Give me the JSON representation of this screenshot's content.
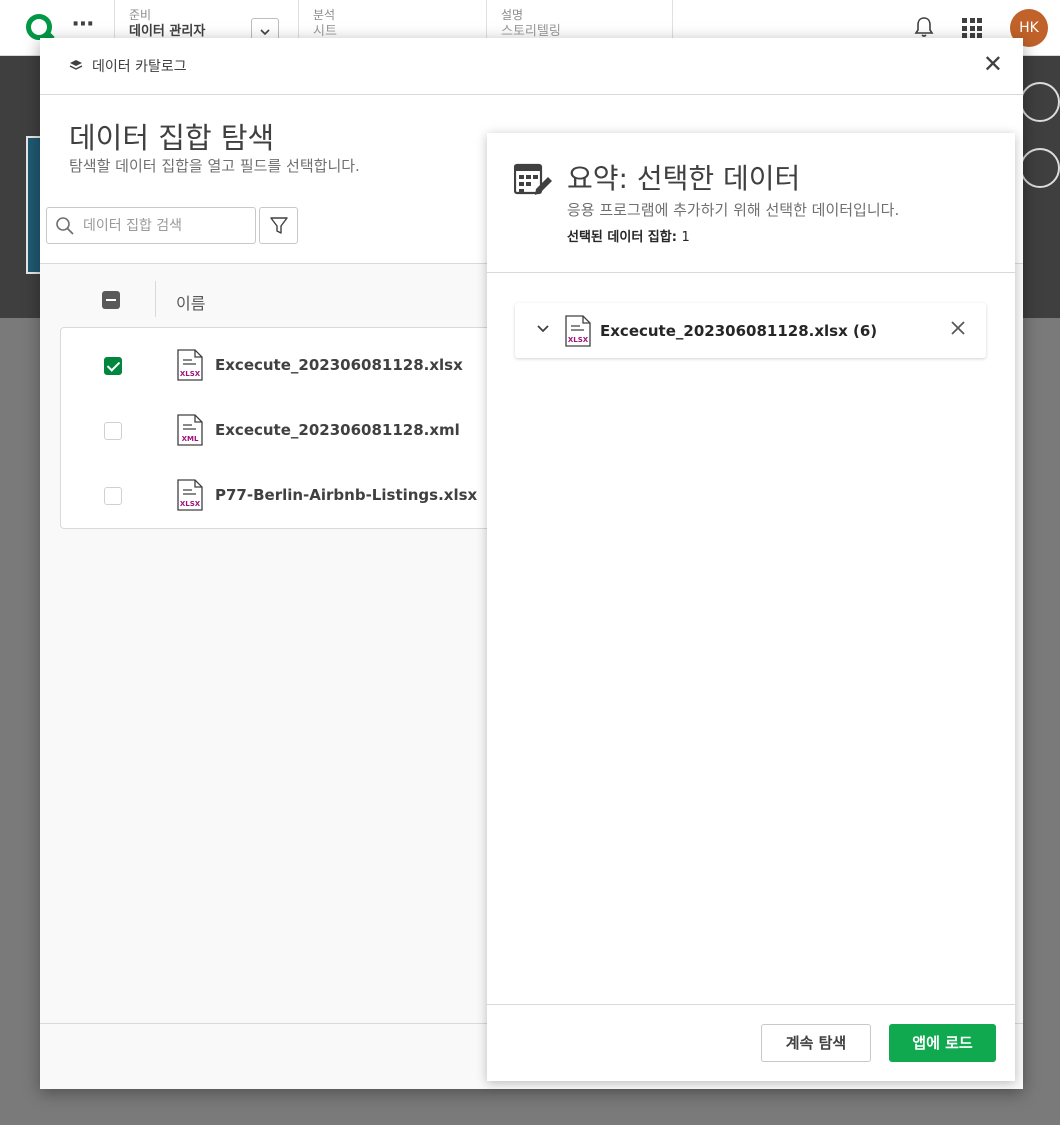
{
  "appbar": {
    "more_label": "⋯",
    "sections": [
      {
        "small": "준비",
        "big": "데이터 관리자"
      },
      {
        "small": "분석",
        "big": "시트"
      },
      {
        "small": "설명",
        "big": "스토리텔링"
      }
    ],
    "avatar_initials": "HK"
  },
  "modal": {
    "header_title": "데이터 카탈로그",
    "close_label": "✕",
    "title": "데이터 집합 탐색",
    "subtitle": "탐색할 데이터 집합을 열고 필드를 선택합니다.",
    "search_placeholder": "데이터 집합 검색",
    "table_header_name": "이름",
    "rows": [
      {
        "name": "Excecute_202306081128.xlsx",
        "type": "XLSX",
        "checked": true
      },
      {
        "name": "Excecute_202306081128.xml",
        "type": "XML",
        "checked": false
      },
      {
        "name": "P77-Berlin-Airbnb-Listings.xlsx",
        "type": "XLSX",
        "checked": false
      }
    ]
  },
  "summary": {
    "title": "요약: 선택한 데이터",
    "subtitle": "응용 프로그램에 추가하기 위해 선택한 데이터입니다.",
    "count_label": "선택된 데이터 집합:",
    "count_value": "1",
    "selected_item": {
      "name": "Excecute_202306081128.xlsx (6)",
      "type": "XLSX"
    },
    "continue_button": "계속 탐색",
    "load_button": "앱에 로드"
  },
  "colors": {
    "accent_green": "#10a950",
    "checkbox_green": "#00873d",
    "file_icon_magenta": "#a0107a",
    "avatar": "#c0622a"
  },
  "icons": [
    "qlik-logo-icon",
    "more-icon",
    "bell-icon",
    "apps-grid-icon",
    "catalog-icon",
    "close-icon",
    "search-icon",
    "filter-icon",
    "xlsx-file-icon",
    "xml-file-icon",
    "table-edit-icon",
    "chevron-down-icon",
    "remove-icon"
  ]
}
